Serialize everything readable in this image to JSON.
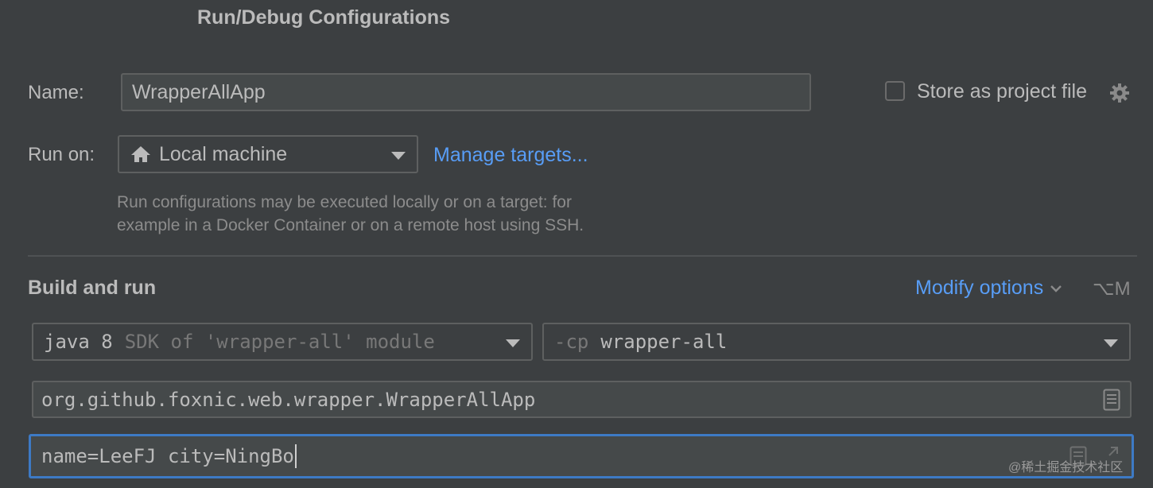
{
  "dialog": {
    "title": "Run/Debug Configurations"
  },
  "name_row": {
    "label": "Name:",
    "value": "WrapperAllApp"
  },
  "store": {
    "label": "Store as project file",
    "checked": false
  },
  "run_on": {
    "label": "Run on:",
    "value": "Local machine",
    "manage_link": "Manage targets..."
  },
  "hint": {
    "line1": "Run configurations may be executed locally or on a target: for",
    "line2": "example in a Docker Container or on a remote host using SSH."
  },
  "build": {
    "heading": "Build and run",
    "modify_options": "Modify options",
    "shortcut": "⌥M",
    "jre": {
      "main": "java 8",
      "detail": "SDK of 'wrapper-all' module"
    },
    "classpath": {
      "prefix": "-cp",
      "value": "wrapper-all"
    },
    "main_class": "org.github.foxnic.web.wrapper.WrapperAllApp",
    "program_args": "name=LeeFJ city=NingBo"
  },
  "watermark": "@稀土掘金技术社区",
  "colors": {
    "background": "#3c3f41",
    "field_bg": "#45494a",
    "border": "#5e6060",
    "focus_border": "#3d7ac5",
    "link": "#589df6"
  }
}
